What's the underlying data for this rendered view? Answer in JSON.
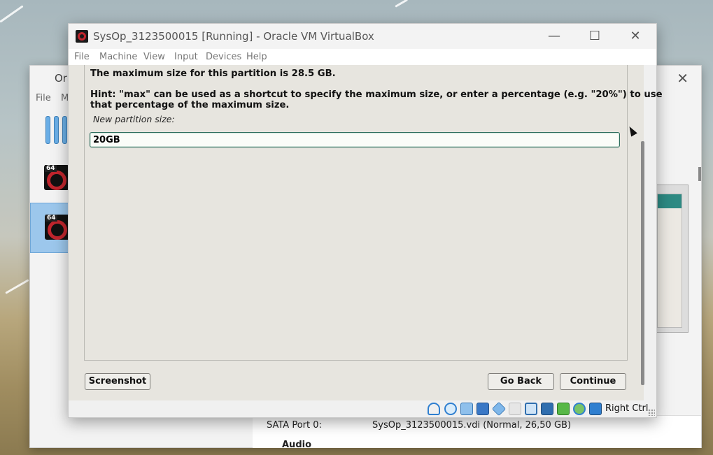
{
  "manager": {
    "title": "Ora",
    "menu": [
      "File",
      "M"
    ],
    "vm_badges": [
      "64",
      "64"
    ],
    "sata_label": "SATA Port 0:",
    "sata_value": "SysOp_3123500015.vdi (Normal, 26,50 GB)",
    "audio_label": "Audio",
    "close_glyph": "✕"
  },
  "vm_window": {
    "title": "SysOp_3123500015 [Running] - Oracle VM VirtualBox",
    "controls": {
      "minimize": "—",
      "maximize": "☐",
      "close": "✕"
    },
    "menu": [
      "File",
      "Machine",
      "View",
      "Input",
      "Devices",
      "Help"
    ]
  },
  "installer": {
    "max_size_text": "The maximum size for this partition is 28.5 GB.",
    "hint_line1": "Hint: \"max\" can be used as a shortcut to specify the maximum size, or enter a percentage (e.g. \"20%\") to use",
    "hint_line2": "that percentage of the maximum size.",
    "size_label": "New partition size:",
    "size_value": "20GB",
    "screenshot_button": "Screenshot",
    "go_back_button": "Go Back",
    "continue_button": "Continue"
  },
  "statusbar": {
    "icons": [
      "hard-disk-icon",
      "optical-drive-icon",
      "audio-icon",
      "network-icon",
      "usb-icon",
      "shared-folders-icon",
      "display-icon",
      "video-capture-icon",
      "recording-icon",
      "cpu-icon",
      "mouse-integration-icon",
      "keyboard-capture-icon"
    ],
    "host_key": "Right Ctrl"
  },
  "colors": {
    "guest_bg": "#e7e5df",
    "input_border": "#2f6e5e",
    "vbox_red": "#c0252d",
    "selected_vm": "#9cc7ec"
  }
}
